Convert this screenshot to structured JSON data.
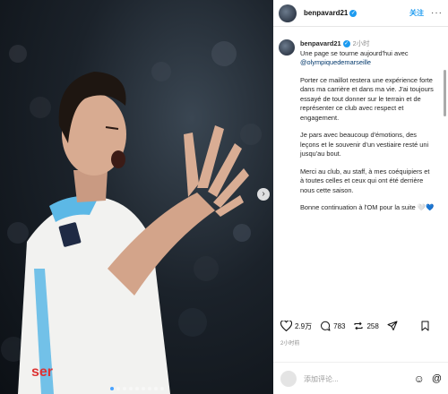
{
  "header": {
    "username": "benpavard21",
    "follow_label": "关注",
    "more_icon": "ellipsis-icon"
  },
  "post": {
    "username": "benpavard21",
    "time": "2小时",
    "line1": "Une page se tourne aujourd'hui avec",
    "mention": "@olympiquedemarseille",
    "para2": "Porter ce maillot restera une expérience forte dans ma carrière et dans ma vie. J'ai toujours essayé de tout donner sur le terrain et de représenter ce club avec respect et engagement.",
    "para3": "Je pars avec beaucoup d'émotions, des leçons et le souvenir d'un vestiaire resté uni jusqu'au bout.",
    "para4": "Merci au club, au staff, à mes coéquipiers et à toutes celles et ceux qui ont été derrière nous cette saison.",
    "para5": "Bonne continuation à l'OM pour la suite 🤍💙"
  },
  "actions": {
    "likes": "2.9万",
    "comments": "783",
    "reposts": "258"
  },
  "posted_time": "2小时前",
  "comment_box": {
    "placeholder": "添加评论..."
  },
  "colors": {
    "accent": "#1d9bf0",
    "jersey_white": "#f2f2f0",
    "jersey_sky": "#5cb8e6"
  },
  "carousel": {
    "slides": 9,
    "active_index": 0
  }
}
